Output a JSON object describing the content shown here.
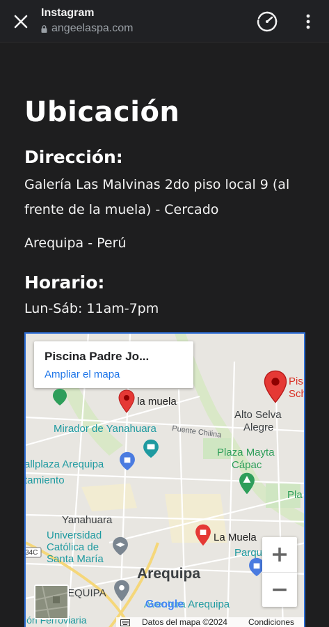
{
  "browser": {
    "title": "Instagram",
    "url": "angeelaspa.com"
  },
  "page": {
    "heading": "Ubicación",
    "address_heading": "Dirección:",
    "address_line1": "Galería Las Malvinas 2do piso local 9 (al",
    "address_line2": "frente de la muela) - Cercado",
    "address_line3": "Arequipa - Perú",
    "hours_heading": "Horario:",
    "hours": "Lun-Sáb: 11am-7pm"
  },
  "map": {
    "place_title": "Piscina Padre Jo...",
    "enlarge_link": "Ampliar el mapa",
    "labels": {
      "la_muela_top": "la muela",
      "pis": "Pis",
      "sch": "Sch",
      "alto_selva": "Alto Selva",
      "alegre": "Alegre",
      "mirador": "Mirador de Yanahuara",
      "puente": "Puente Chilina",
      "plaza_mayta": "Plaza Mayta",
      "capac": "Cápac",
      "mallplaza": "allplaza Arequipa",
      "tamiento": "tamiento",
      "pla": "Pla",
      "yanahuara": "Yanahuara",
      "universidad": "Universidad",
      "catolica": "Católica de",
      "santa_maria": "Santa María",
      "la_muela_bottom": "La Muela",
      "parque": "Parqu",
      "rout": "34C",
      "arequipa": "Arequipa",
      "equipa": "EQUIPA",
      "aventura": "Aventura Arequipa",
      "ferroviaria": "ión Ferroviaria",
      "google": "Google",
      "map_data": "Datos del mapa ©2024",
      "conditions": "Condiciones"
    },
    "zoom_in": "+",
    "zoom_out": "−"
  },
  "colors": {
    "page_bg": "#1e1e1f",
    "map_border": "#2f6fd6",
    "pin_red": "#e53935",
    "link_blue": "#1a73e8",
    "poi_teal": "#1e9aa0",
    "park_green": "#2e9e5a"
  }
}
